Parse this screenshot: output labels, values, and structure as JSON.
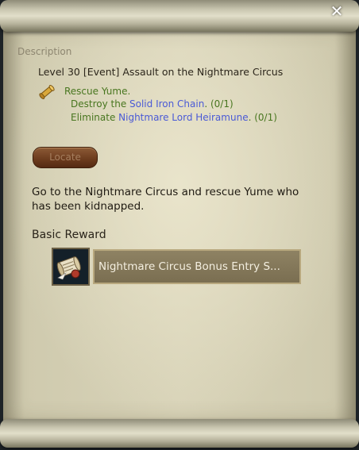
{
  "window": {
    "close_glyph": "✕"
  },
  "description": {
    "section_label": "Description",
    "quest_title": "Level 30 [Event] Assault on the Nightmare Circus",
    "quest_icon": "scroll-quest-icon",
    "objective_main": "Rescue Yume.",
    "objectives": [
      {
        "prefix": "Destroy the ",
        "target": "Solid Iron Chain",
        "suffix": ". (0/1)"
      },
      {
        "prefix": "Eliminate ",
        "target": "Nightmare Lord Heiramune",
        "suffix": ". (0/1)"
      }
    ],
    "locate_label": "Locate",
    "body_text": "Go to the Nightmare Circus and rescue Yume who has been kidnapped."
  },
  "reward": {
    "section_label": "Basic Reward",
    "item_name": "Nightmare Circus Bonus Entry S...",
    "item_icon": "scroll-letter-icon"
  },
  "colors": {
    "objective_green": "#48761f",
    "target_blue": "#4a5ad6",
    "button_brown": "#6b3b1d"
  }
}
